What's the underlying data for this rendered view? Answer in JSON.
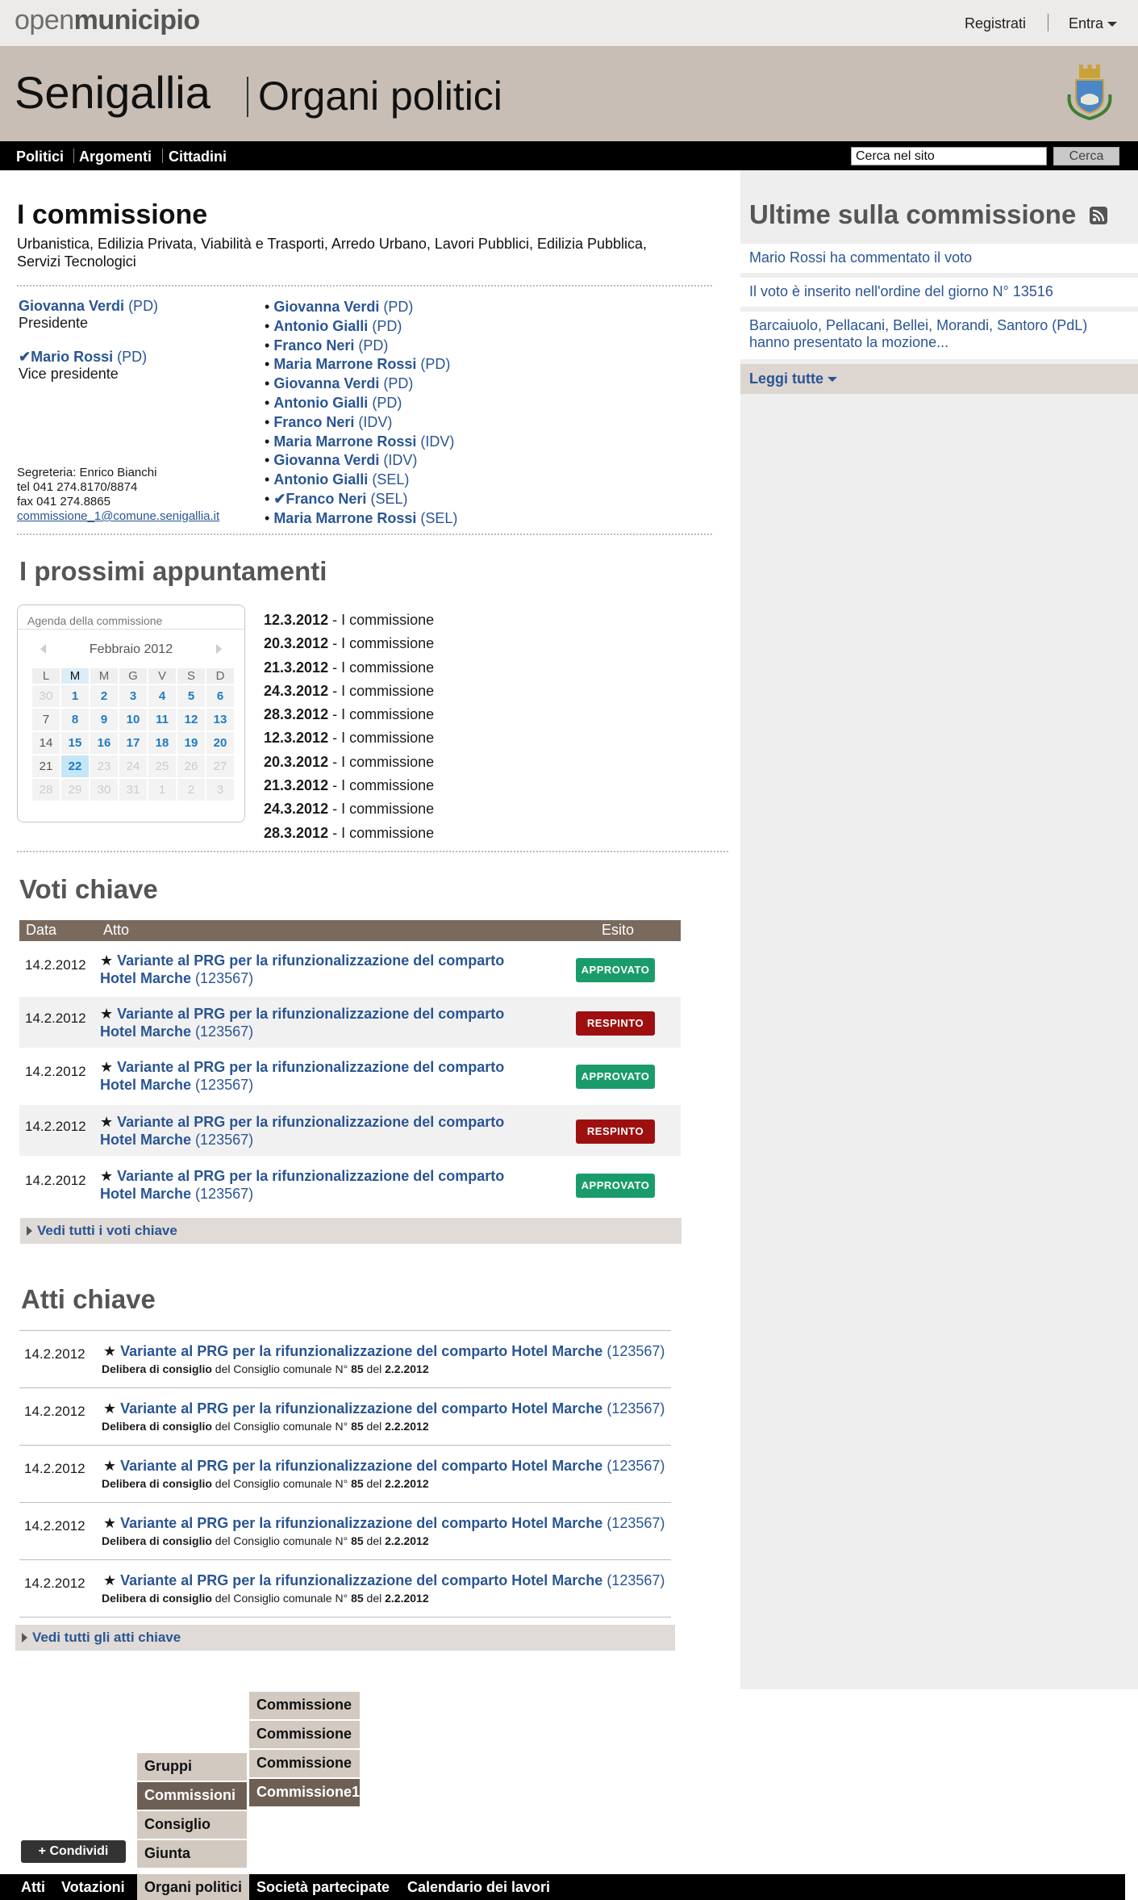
{
  "topbar": {
    "logo_light": "open",
    "logo_bold": "municipio",
    "register": "Registrati",
    "enter": "Entra"
  },
  "header": {
    "city": "Senigallia",
    "section": "Organi politici"
  },
  "nav": {
    "items": [
      "Politici",
      "Argomenti",
      "Cittadini"
    ],
    "search_placeholder": "Cerca nel sito",
    "search_button": "Cerca"
  },
  "commission": {
    "title": "I commissione",
    "description": "Urbanistica, Edilizia Privata, Viabilità e Trasporti, Arredo Urbano, Lavori Pubblici, Edilizia Pubblica, Servizi Tecnologici",
    "president": {
      "name": "Giovanna Verdi",
      "party": "(PD)",
      "role": "Presidente"
    },
    "vice": {
      "check": "✔",
      "name": "Mario Rossi",
      "party": "(PD)",
      "role": "Vice presidente"
    },
    "secretary": {
      "line1": "Segreteria: Enrico Bianchi",
      "tel": "tel 041 274.8170/8874",
      "fax": "fax 041 274.8865",
      "email": "commissione_1@comune.senigallia.it"
    },
    "members": [
      {
        "check": "",
        "name": "Giovanna Verdi",
        "party": "(PD)"
      },
      {
        "check": "",
        "name": "Antonio Gialli",
        "party": "(PD)"
      },
      {
        "check": "",
        "name": "Franco Neri",
        "party": "(PD)"
      },
      {
        "check": "",
        "name": "Maria Marrone Rossi",
        "party": "(PD)"
      },
      {
        "check": "",
        "name": "Giovanna Verdi",
        "party": "(PD)"
      },
      {
        "check": "",
        "name": "Antonio Gialli",
        "party": "(PD)"
      },
      {
        "check": "",
        "name": "Franco Neri",
        "party": "(IDV)"
      },
      {
        "check": "",
        "name": "Maria Marrone Rossi",
        "party": "(IDV)"
      },
      {
        "check": "",
        "name": "Giovanna Verdi",
        "party": "(IDV)"
      },
      {
        "check": "",
        "name": "Antonio Gialli",
        "party": "(SEL)"
      },
      {
        "check": "✔",
        "name": "Franco Neri",
        "party": "(SEL)"
      },
      {
        "check": "",
        "name": "Maria Marrone Rossi",
        "party": "(SEL)"
      }
    ]
  },
  "appointments": {
    "title": "I prossimi appuntamenti",
    "calendar_caption": "Agenda della commissione",
    "month": "Febbraio 2012",
    "weekdays": [
      "L",
      "M",
      "M",
      "G",
      "V",
      "S",
      "D"
    ],
    "weeks": [
      [
        "30",
        "1",
        "2",
        "3",
        "4",
        "5",
        "6"
      ],
      [
        "7",
        "8",
        "9",
        "10",
        "11",
        "12",
        "13"
      ],
      [
        "14",
        "15",
        "16",
        "17",
        "18",
        "19",
        "20"
      ],
      [
        "21",
        "22",
        "23",
        "24",
        "25",
        "26",
        "27"
      ],
      [
        "28",
        "29",
        "30",
        "31",
        "1",
        "2",
        "3"
      ]
    ],
    "events": [
      {
        "date": "12.3.2012",
        "sep": " - ",
        "label": "I commissione"
      },
      {
        "date": "20.3.2012",
        "sep": " - ",
        "label": "I commissione"
      },
      {
        "date": "21.3.2012",
        "sep": " - ",
        "label": "I commissione"
      },
      {
        "date": "24.3.2012",
        "sep": " - ",
        "label": "I commissione"
      },
      {
        "date": "28.3.2012",
        "sep": " - ",
        "label": "I commissione"
      },
      {
        "date": "12.3.2012",
        "sep": " - ",
        "label": "I commissione"
      },
      {
        "date": "20.3.2012",
        "sep": " - ",
        "label": "I commissione"
      },
      {
        "date": "21.3.2012",
        "sep": " - ",
        "label": "I commissione"
      },
      {
        "date": "24.3.2012",
        "sep": " - ",
        "label": "I commissione"
      },
      {
        "date": "28.3.2012",
        "sep": " - ",
        "label": "I commissione"
      }
    ]
  },
  "votes": {
    "title": "Voti chiave",
    "columns": {
      "date": "Data",
      "act": "Atto",
      "outcome": "Esito"
    },
    "rows": [
      {
        "date": "14.2.2012",
        "star": "★",
        "title": "Variante al PRG per la rifunzionalizzazione del comparto Hotel Marche",
        "code": "(123567)",
        "outcome": "APPROVATO",
        "status": "ok"
      },
      {
        "date": "14.2.2012",
        "star": "★",
        "title": "Variante al PRG per la rifunzionalizzazione del comparto Hotel Marche",
        "code": "(123567)",
        "outcome": "RESPINTO",
        "status": "ko"
      },
      {
        "date": "14.2.2012",
        "star": "★",
        "title": "Variante al PRG per la rifunzionalizzazione del comparto Hotel Marche",
        "code": "(123567)",
        "outcome": "APPROVATO",
        "status": "ok"
      },
      {
        "date": "14.2.2012",
        "star": "★",
        "title": "Variante al PRG per la rifunzionalizzazione del comparto Hotel Marche",
        "code": "(123567)",
        "outcome": "RESPINTO",
        "status": "ko"
      },
      {
        "date": "14.2.2012",
        "star": "★",
        "title": "Variante al PRG per la rifunzionalizzazione del comparto Hotel Marche",
        "code": "(123567)",
        "outcome": "APPROVATO",
        "status": "ok"
      }
    ],
    "see_all": "Vedi tutti i voti chiave"
  },
  "acts": {
    "title": "Atti chiave",
    "rows": [
      {
        "date": "14.2.2012",
        "star": "★",
        "title": "Variante al PRG per la rifunzionalizzazione del comparto Hotel Marche",
        "code": "(123567)",
        "type": "Delibera di consiglio",
        "by": " del Consiglio comunale N° ",
        "num": "85",
        "del": " del ",
        "when": "2.2.2012"
      },
      {
        "date": "14.2.2012",
        "star": "★",
        "title": "Variante al PRG per la rifunzionalizzazione del comparto Hotel Marche",
        "code": "(123567)",
        "type": "Delibera di consiglio",
        "by": " del Consiglio comunale N° ",
        "num": "85",
        "del": " del ",
        "when": "2.2.2012"
      },
      {
        "date": "14.2.2012",
        "star": "★",
        "title": "Variante al PRG per la rifunzionalizzazione del comparto Hotel Marche",
        "code": "(123567)",
        "type": "Delibera di consiglio",
        "by": " del Consiglio comunale N° ",
        "num": "85",
        "del": " del ",
        "when": "2.2.2012"
      },
      {
        "date": "14.2.2012",
        "star": "★",
        "title": "Variante al PRG per la rifunzionalizzazione del comparto Hotel Marche",
        "code": "(123567)",
        "type": "Delibera di consiglio",
        "by": " del Consiglio comunale N° ",
        "num": "85",
        "del": " del ",
        "when": "2.2.2012"
      },
      {
        "date": "14.2.2012",
        "star": "★",
        "title": "Variante al PRG per la rifunzionalizzazione del comparto Hotel Marche",
        "code": "(123567)",
        "type": "Delibera di consiglio",
        "by": " del Consiglio comunale N° ",
        "num": "85",
        "del": " del ",
        "when": "2.2.2012"
      }
    ],
    "see_all": "Vedi tutti gli atti chiave"
  },
  "sidebar": {
    "title": "Ultime sulla commissione",
    "icon": "rss-icon",
    "news": [
      "Mario Rossi ha commentato il voto",
      "Il voto è inserito nell'ordine del giorno N° 13516",
      "Barcaiuolo, Pellacani, Bellei, Morandi, Santoro (PdL) hanno presentato la mozione..."
    ],
    "read_all": "Leggi tutte"
  },
  "bottom": {
    "submenu2": [
      "Commissione",
      "Commissione",
      "Commissione",
      "Commissione1"
    ],
    "submenu1": [
      "Gruppi",
      "Commissioni",
      "Consiglio",
      "Giunta"
    ],
    "share": "+ Condividi",
    "footer": [
      "Atti",
      "Votazioni",
      "Organi politici",
      "Società partecipate",
      "Calendario dei lavori"
    ]
  },
  "colors": {
    "link": "#2a5594",
    "approved": "#1a9c6a",
    "rejected": "#9e1010",
    "table_header": "#7a6a5e",
    "header_band": "#c8beb6"
  }
}
